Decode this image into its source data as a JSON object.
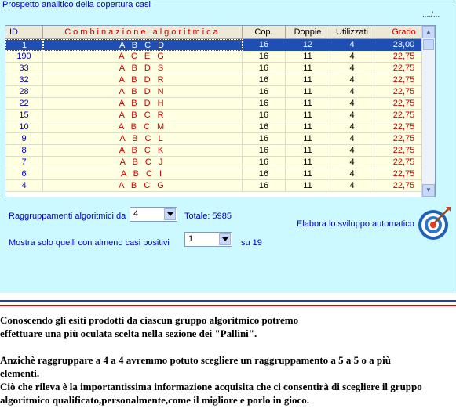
{
  "panel": {
    "group_title": "Prospetto analitico della copertura casi",
    "path_hint": "..../..."
  },
  "grid": {
    "columns": [
      "ID",
      "Combinazione algoritmica",
      "Cop.",
      "Doppie",
      "Utilizzati",
      "Grado"
    ],
    "rows": [
      {
        "id": "1",
        "comb": "A B C D",
        "cop": "16",
        "doppie": "12",
        "utilizzati": "4",
        "grado": "23,00",
        "selected": true
      },
      {
        "id": "190",
        "comb": "A C E G",
        "cop": "16",
        "doppie": "11",
        "utilizzati": "4",
        "grado": "22,75"
      },
      {
        "id": "33",
        "comb": "A B D S",
        "cop": "16",
        "doppie": "11",
        "utilizzati": "4",
        "grado": "22,75"
      },
      {
        "id": "32",
        "comb": "A B D R",
        "cop": "16",
        "doppie": "11",
        "utilizzati": "4",
        "grado": "22,75"
      },
      {
        "id": "28",
        "comb": "A B D N",
        "cop": "16",
        "doppie": "11",
        "utilizzati": "4",
        "grado": "22,75"
      },
      {
        "id": "22",
        "comb": "A B D H",
        "cop": "16",
        "doppie": "11",
        "utilizzati": "4",
        "grado": "22,75"
      },
      {
        "id": "15",
        "comb": "A B C R",
        "cop": "16",
        "doppie": "11",
        "utilizzati": "4",
        "grado": "22,75"
      },
      {
        "id": "10",
        "comb": "A B C M",
        "cop": "16",
        "doppie": "11",
        "utilizzati": "4",
        "grado": "22,75"
      },
      {
        "id": "9",
        "comb": "A B C L",
        "cop": "16",
        "doppie": "11",
        "utilizzati": "4",
        "grado": "22,75"
      },
      {
        "id": "8",
        "comb": "A B C K",
        "cop": "16",
        "doppie": "11",
        "utilizzati": "4",
        "grado": "22,75"
      },
      {
        "id": "7",
        "comb": "A B C J",
        "cop": "16",
        "doppie": "11",
        "utilizzati": "4",
        "grado": "22,75"
      },
      {
        "id": "6",
        "comb": "A B C I",
        "cop": "16",
        "doppie": "11",
        "utilizzati": "4",
        "grado": "22,75"
      },
      {
        "id": "4",
        "comb": "A B C G",
        "cop": "16",
        "doppie": "11",
        "utilizzati": "4",
        "grado": "22,75"
      }
    ]
  },
  "controls": {
    "group_label": "Raggruppamenti algoritmici da",
    "group_value": "4",
    "total_text": "Totale: 5985",
    "positive_label": "Mostra solo quelli con almeno casi positivi",
    "positive_value": "1",
    "positive_of": "su 19",
    "auto_label": "Elabora lo sviluppo automatico"
  },
  "colors": {
    "panel_bg": "#ccf8ff",
    "row_bg": "#ffffe1",
    "selection": "#1f4fb4",
    "band_blue": "#1a3fb5",
    "band_red": "#e00000"
  },
  "icons": [
    "target-icon",
    "chevron-down-icon",
    "chevron-up-icon"
  ],
  "text": {
    "p1_line1": "Conoscendo gli esiti   prodotti da ciascun gruppo algoritmico potremo",
    "p1_line2": "effettuare una più oculata scelta nella sezione dei \"Pallini\".",
    "p2_line1": "Anzichè raggruppare a 4 a 4 avremmo potuto scegliere un raggruppamento a 5 a 5 o a più",
    "p2_line2": "elementi.",
    "p3_line1": "Ciò che rileva è la importantissima informazione acquisita che ci consentirà di scegliere il gruppo",
    "p3_line2": "algoritmico qualificato,personalmente,come il migliore e porlo in gioco."
  }
}
